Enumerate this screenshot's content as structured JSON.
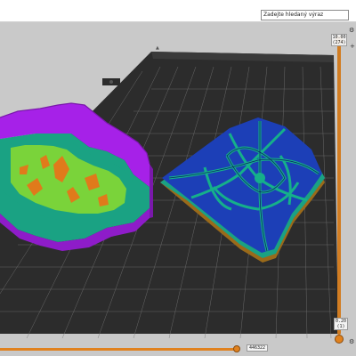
{
  "search": {
    "placeholder": "Zadejte hledaný výraz"
  },
  "layer_slider": {
    "top_value": "10.00",
    "top_layer": "(274)",
    "bottom_value": "0.20",
    "bottom_layer": "(1)"
  },
  "move_slider": {
    "value": "446322"
  },
  "colors": {
    "bed": "#2b2b2b",
    "grid": "#9a9a9a",
    "perimeter": "#a621e8",
    "infill": "#7ad33a",
    "top_solid": "#1c3fb7",
    "wipe": "#15b08a",
    "orange_fill": "#e07a1b",
    "slider": "#e0811e"
  },
  "icons": [
    "cog-icon",
    "layers-icon",
    "plus-icon"
  ]
}
